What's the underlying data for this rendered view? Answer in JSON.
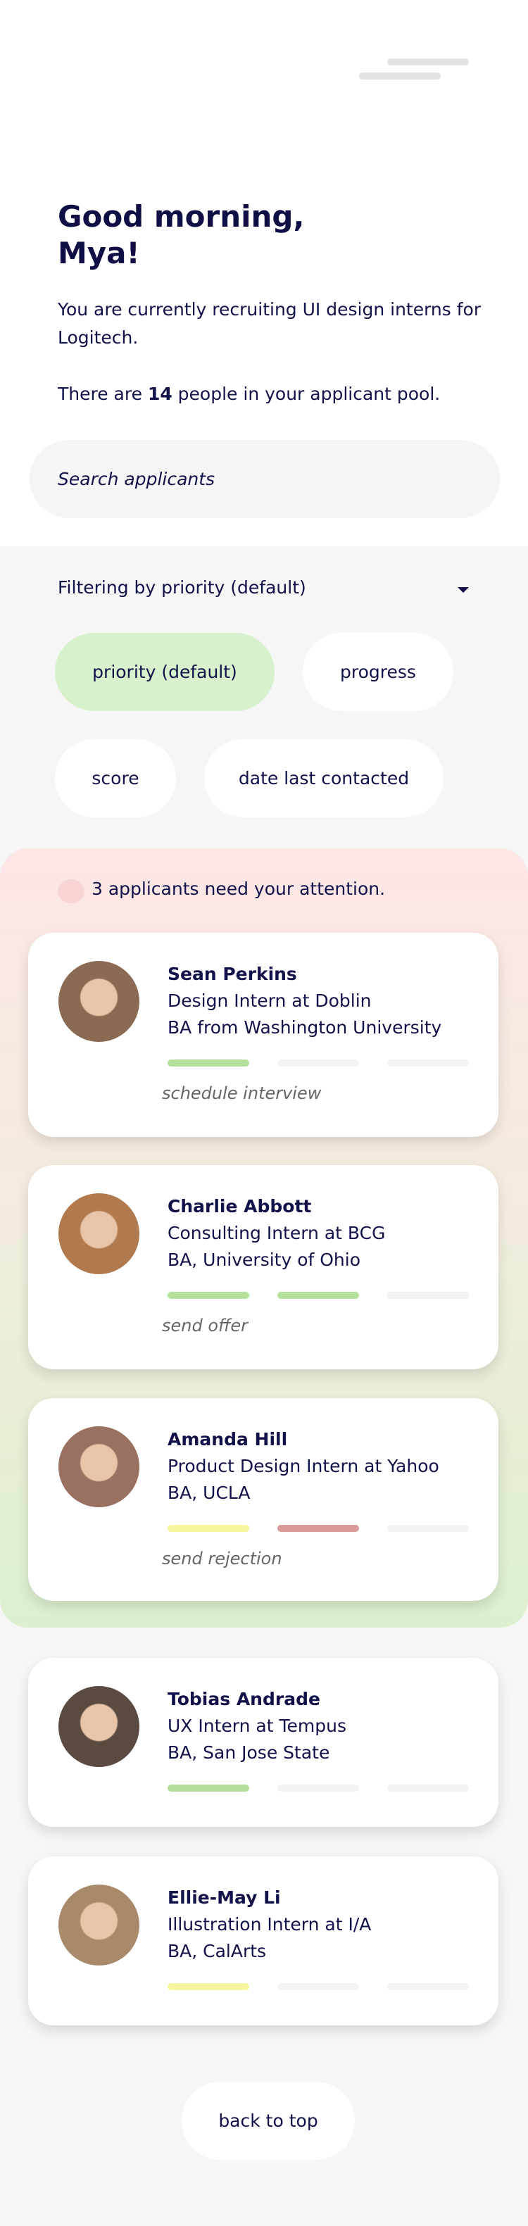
{
  "header": {
    "menu_icon": "hamburger-menu-icon"
  },
  "greeting": {
    "line1": "Good morning,",
    "line2": "Mya!"
  },
  "intro": {
    "text": "You are currently recruiting UI design interns for Logitech.",
    "pool_prefix": "There are ",
    "pool_count": "14",
    "pool_suffix": " people in your applicant pool."
  },
  "search": {
    "placeholder": "Search applicants"
  },
  "filter": {
    "label": "Filtering by priority (default)",
    "options": [
      "priority (default)",
      "progress",
      "score",
      "date last contacted"
    ],
    "selected": "priority (default)"
  },
  "attention": {
    "text": "3 applicants need your attention."
  },
  "colors": {
    "accent_green": "#d6f1cb",
    "bar_green": "#b3e09a",
    "bar_yellow": "#f7f59e",
    "bar_red": "#d99a9a",
    "bar_empty": "#f3f3f3",
    "text": "#12124a"
  },
  "applicants": [
    {
      "name": "Sean Perkins",
      "role": "Design Intern at Doblin",
      "education": "BA from Washington University",
      "progress": [
        "green",
        "empty",
        "empty"
      ],
      "action": "schedule interview"
    },
    {
      "name": "Charlie Abbott",
      "role": "Consulting Intern at BCG",
      "education": "BA, University of Ohio",
      "progress": [
        "green",
        "green",
        "empty"
      ],
      "action": "send offer"
    },
    {
      "name": "Amanda Hill",
      "role": "Product Design Intern at Yahoo",
      "education": "BA, UCLA",
      "progress": [
        "yellow",
        "red",
        "empty"
      ],
      "action": "send rejection"
    },
    {
      "name": "Tobias Andrade",
      "role": "UX Intern at Tempus",
      "education": "BA, San Jose State",
      "progress": [
        "green",
        "empty",
        "empty"
      ]
    },
    {
      "name": "Ellie-May Li",
      "role": "Illustration Intern at I/A",
      "education": "BA, CalArts",
      "progress": [
        "yellow",
        "empty",
        "empty"
      ]
    }
  ],
  "footer": {
    "back_to_top": "back to top"
  }
}
